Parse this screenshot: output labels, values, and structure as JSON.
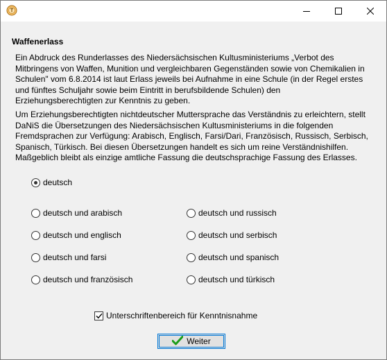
{
  "window": {
    "title": "",
    "controls": {
      "minimize": "minimize-icon",
      "maximize": "maximize-icon",
      "close": "close-icon"
    }
  },
  "heading": "Waffenerlass",
  "paragraph1": [
    "Ein Abdruck des Runderlasses des Niedersächsischen Kultusministeriums „Verbot des",
    "Mitbringens von Waffen, Munition und vergleichbaren Gegenständen sowie von Chemikalien in",
    "Schulen\" vom 6.8.2014 ist laut Erlass jeweils bei Aufnahme in eine Schule (in der Regel erstes",
    "und fünftes Schuljahr sowie beim Eintritt in berufsbildende Schulen) den",
    "Erziehungsberechtigten zur Kenntnis zu geben."
  ],
  "paragraph2": [
    "Um Erziehungsberechtigten nichtdeutscher Muttersprache das Verständnis zu erleichtern, stellt",
    "DaNiS die Übersetzungen des Niedersächsischen Kultusministeriums in die folgenden",
    "Fremdsprachen zur Verfügung: Arabisch, Englisch, Farsi/Dari, Französisch, Russisch, Serbisch,",
    "Spanisch, Türkisch. Bei diesen Übersetzungen handelt es sich um reine Verständnishilfen.",
    "Maßgeblich bleibt als einzige amtliche Fassung die deutschsprachige Fassung des Erlasses."
  ],
  "languages": {
    "deutsch": "deutsch",
    "arabisch": "deutsch und arabisch",
    "englisch": "deutsch und englisch",
    "farsi": "deutsch und farsi",
    "franzoesisch": "deutsch und französisch",
    "russisch": "deutsch und russisch",
    "serbisch": "deutsch und serbisch",
    "spanisch": "deutsch und spanisch",
    "tuerkisch": "deutsch und türkisch",
    "selected": "deutsch"
  },
  "checkbox": {
    "label": "Unterschriftenbereich für Kenntnisnahme",
    "checked": true
  },
  "button": {
    "label": "Weiter",
    "icon": "checkmark-icon"
  },
  "colors": {
    "accent": "#0078d7",
    "check_green": "#1a9d1a",
    "app_icon": "#e8a33a"
  }
}
